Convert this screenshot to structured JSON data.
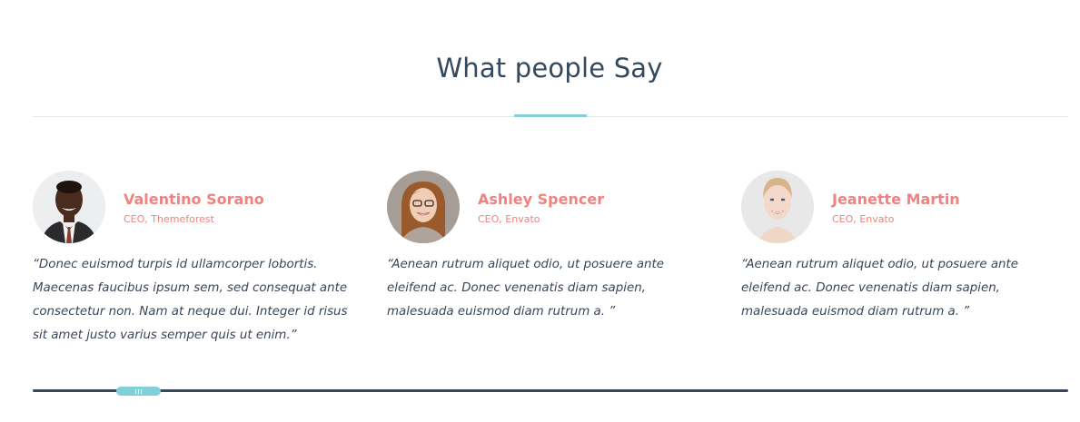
{
  "section": {
    "title": "What people Say"
  },
  "testimonials": [
    {
      "name": "Valentino Sorano",
      "role": "CEO, Themeforest",
      "quote": "“Donec euismod turpis id ullamcorper lobortis. Maecenas faucibus ipsum sem, sed consequat ante consectetur non. Nam at neque dui. Integer id risus sit amet justo varius semper quis ut enim.”"
    },
    {
      "name": "Ashley Spencer",
      "role": "CEO, Envato",
      "quote": "“Aenean rutrum aliquet odio, ut posuere ante eleifend ac. Donec venenatis diam sapien, malesuada euismod diam rutrum a. ”"
    },
    {
      "name": "Jeanette Martin",
      "role": "CEO, Envato",
      "quote": "“Aenean rutrum aliquet odio, ut posuere ante eleifend ac. Donec venenatis diam sapien, malesuada euismod diam rutrum a. ”"
    }
  ],
  "carousel": {
    "scroll_position_fraction": 0.08
  },
  "colors": {
    "heading": "#34495e",
    "accent": "#7fd0d9",
    "name": "#f0827f",
    "text": "#3a4656",
    "track": "#34495e"
  }
}
